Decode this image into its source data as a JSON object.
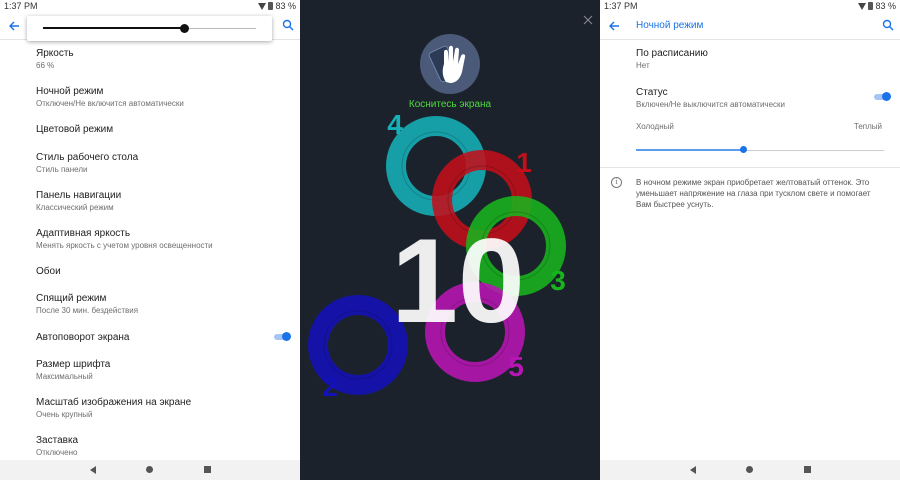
{
  "status": {
    "time": "1:37 PM",
    "battery": "83 %"
  },
  "left": {
    "brightness_level": 0.66,
    "settings": [
      {
        "title": "Яркость",
        "sub": "66 %"
      },
      {
        "title": "Ночной режим",
        "sub": "Отключен/Не включится автоматически"
      },
      {
        "title": "Цветовой режим",
        "sub": ""
      },
      {
        "title": "Стиль рабочего стола",
        "sub": "Стиль панели"
      },
      {
        "title": "Панель навигации",
        "sub": "Классический режим"
      },
      {
        "title": "Адаптивная яркость",
        "sub": "Менять яркость с учетом уровня освещенности"
      },
      {
        "title": "Обои",
        "sub": ""
      },
      {
        "title": "Спящий режим",
        "sub": "После 30 мин. бездействия"
      },
      {
        "title": "Автоповорот экрана",
        "sub": ""
      },
      {
        "title": "Размер шрифта",
        "sub": "Максимальный"
      },
      {
        "title": "Масштаб изображения на экране",
        "sub": "Очень крупный"
      },
      {
        "title": "Заставка",
        "sub": "Отключено"
      }
    ],
    "autorotate_on": true
  },
  "middle": {
    "touch_text": "Коснитесь экрана",
    "count": "10",
    "rings": [
      {
        "label": "1",
        "color": "#c40f1a"
      },
      {
        "label": "2",
        "color": "#1411b8"
      },
      {
        "label": "3",
        "color": "#18b41e"
      },
      {
        "label": "4",
        "color": "#16b1b8"
      },
      {
        "label": "5",
        "color": "#b816b4"
      }
    ]
  },
  "right": {
    "title": "Ночной режим",
    "schedule": {
      "title": "По расписанию",
      "sub": "Нет"
    },
    "status": {
      "title": "Статус",
      "sub": "Включен/Не выключится автоматически",
      "on": true
    },
    "cold_label": "Холодный",
    "warm_label": "Теплый",
    "intensity": 0.43,
    "info": "В ночном режиме экран приобретает желтоватый оттенок. Это уменьшает напряжение на глаза при тусклом свете и помогает Вам быстрее уснуть."
  },
  "colors": {
    "accent": "#1a73e8",
    "dark_bg": "#1c222c",
    "green_text": "#4ddc3a"
  },
  "icons": [
    "back-arrow-icon",
    "search-icon",
    "wifi-icon",
    "battery-icon",
    "close-icon",
    "touch-hand-icon",
    "info-icon"
  ]
}
